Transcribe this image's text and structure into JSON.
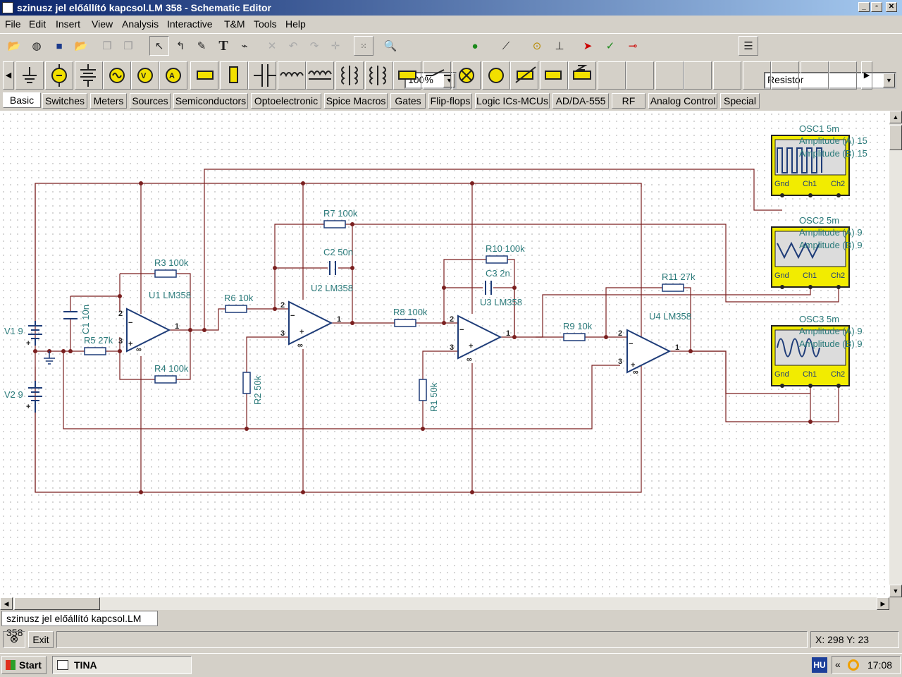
{
  "window": {
    "title": "szinusz jel előállító kapcsol.LM 358 - Schematic Editor",
    "minimize": "_",
    "restore": "▫",
    "close": "✕"
  },
  "menu": [
    "File",
    "Edit",
    "Insert",
    "View",
    "Analysis",
    "Interactive",
    "T&M",
    "Tools",
    "Help"
  ],
  "toolbar": {
    "zoom_value": "100%",
    "component_value": "Resistor"
  },
  "component_tabs": [
    "Basic",
    "Switches",
    "Meters",
    "Sources",
    "Semiconductors",
    "Optoelectronic",
    "Spice Macros",
    "Gates",
    "Flip-flops",
    "Logic ICs-MCUs",
    "AD/DA-555",
    "RF",
    "Analog Control",
    "Special"
  ],
  "schematic": {
    "components": {
      "r3": "R3 100k",
      "r4": "R4 100k",
      "r5": "R5 27k",
      "r6": "R6 10k",
      "r7": "R7 100k",
      "r8": "R8 100k",
      "r9": "R9 10k",
      "r10": "R10 100k",
      "r11": "R11 27k",
      "r1": "R1 50k",
      "r2": "R2 50k",
      "c1": "C1 10n",
      "c2": "C2 50n",
      "c3": "C3 2n",
      "u1": "U1 LM358",
      "u2": "U2 LM358",
      "u3": "U3 LM358",
      "u4": "U4 LM358",
      "v1": "V1 9",
      "v2": "V2 9"
    },
    "pins": {
      "plus": "+",
      "minus": "−",
      "inf": "∞",
      "p1": "1",
      "p2": "2",
      "p3": "3"
    },
    "oscilloscopes": [
      {
        "name": "OSC1 5m",
        "amp_a": "Amplitude (A) 15",
        "amp_b": "Amplitude (B) 15",
        "gnd": "Gnd",
        "ch1": "Ch1",
        "ch2": "Ch2"
      },
      {
        "name": "OSC2 5m",
        "amp_a": "Amplitude (A) 9",
        "amp_b": "Amplitude (B) 9",
        "gnd": "Gnd",
        "ch1": "Ch1",
        "ch2": "Ch2"
      },
      {
        "name": "OSC3 5m",
        "amp_a": "Amplitude (A) 9",
        "amp_b": "Amplitude (B) 9",
        "gnd": "Gnd",
        "ch1": "Ch1",
        "ch2": "Ch2"
      }
    ],
    "colors": {
      "wire": "#7a1f1f",
      "component": "#1e3c78",
      "label": "#2a7a7a",
      "osc_body": "#f2ec00"
    }
  },
  "document_tab": "szinusz jel előállító kapcsol.LM 358",
  "status": {
    "exit_label": "Exit",
    "coords": "X: 298  Y: 23"
  },
  "taskbar": {
    "start_label": "Start",
    "task_label": "TINA",
    "lang": "HU",
    "chevron": "«",
    "clock": "17:08"
  }
}
